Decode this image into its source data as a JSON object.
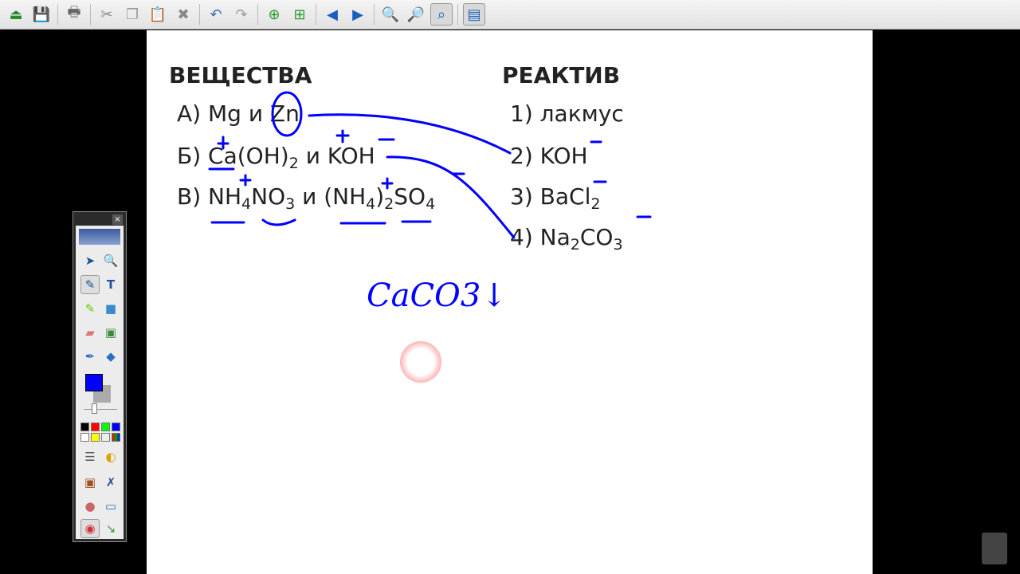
{
  "toolbar": {
    "buttons": [
      "open-icon",
      "save-icon",
      "print-icon",
      "cut-icon",
      "copy-icon",
      "paste-icon",
      "delete-icon",
      "undo-icon",
      "redo-icon",
      "new-page-icon",
      "duplicate-page-icon",
      "previous-page-icon",
      "next-page-icon",
      "zoom-in-icon",
      "zoom-out-icon",
      "zoom-fit-icon",
      "window-mode-icon"
    ]
  },
  "left": {
    "heading": "ВЕЩЕСТВА",
    "items": [
      {
        "label": "А)",
        "text": "Mg и Zn"
      },
      {
        "label": "Б)",
        "a": "Ca(OH)",
        "a_sub": "2",
        "mid": " и KOH"
      },
      {
        "label": "В)",
        "a": "NH",
        "a_sub": "4",
        "b": "NO",
        "b_sub": "3",
        "mid": " и (NH",
        "c_sub": "4",
        "d": ")",
        "d_sub": "2",
        "e": "SO",
        "e_sub": "4"
      }
    ]
  },
  "right": {
    "heading": "РЕАКТИВ",
    "items": [
      {
        "label": "1)",
        "text": "лакмус"
      },
      {
        "label": "2)",
        "text": "KOH"
      },
      {
        "label": "3)",
        "text": "BaCl",
        "sub": "2"
      },
      {
        "label": "4)",
        "text": "Na",
        "sub": "2",
        "text2": "CO",
        "sub2": "3"
      }
    ]
  },
  "ink": {
    "color": "#0000ff",
    "note": "CaCO3↓"
  },
  "palette": {
    "close": "×",
    "selected_color": "#0000ff",
    "swatches": [
      "#000000",
      "#ff0000",
      "#00ff00",
      "#0000ff",
      "#ffffff",
      "#ffff00"
    ]
  }
}
